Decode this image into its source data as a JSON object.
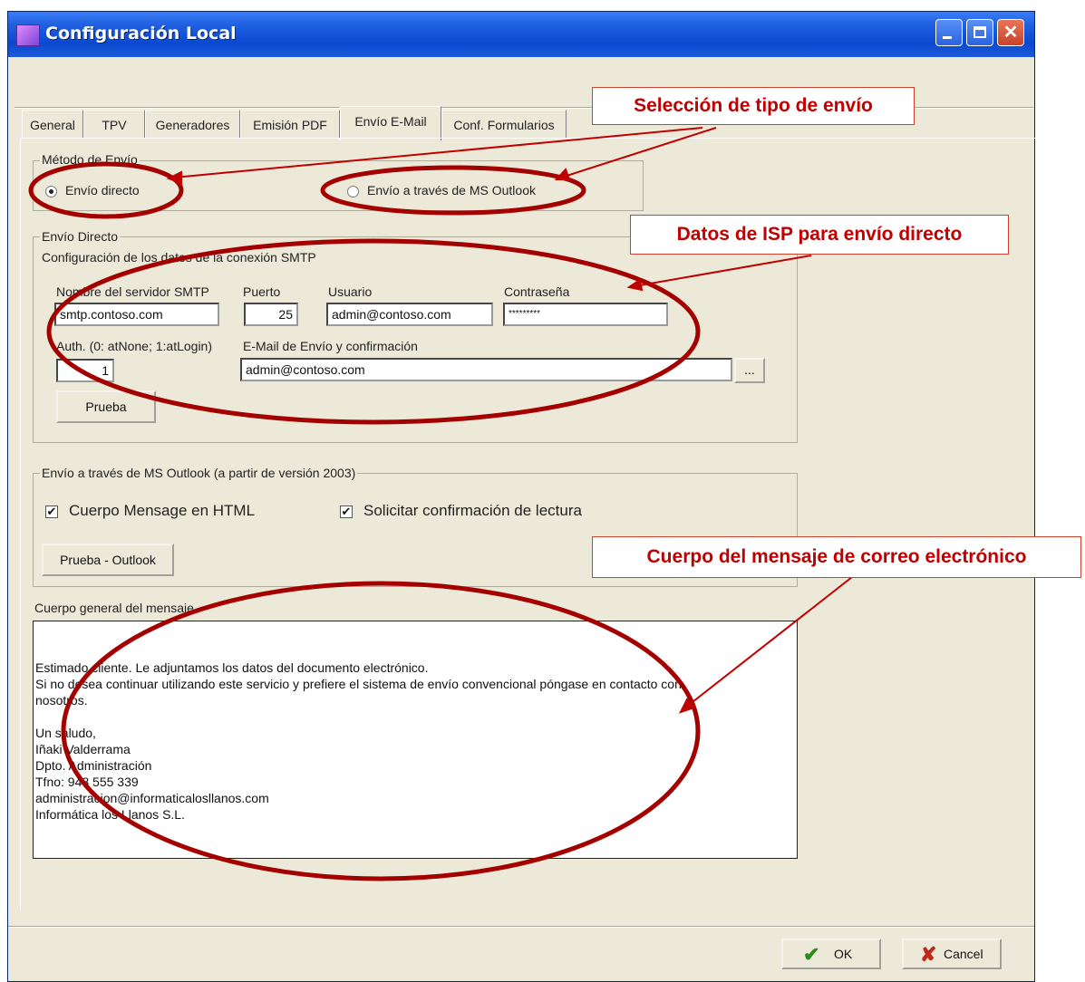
{
  "window": {
    "title": "Configuración Local"
  },
  "tabs": [
    {
      "label": "General",
      "active": false
    },
    {
      "label": "TPV",
      "active": false
    },
    {
      "label": "Generadores",
      "active": false
    },
    {
      "label": "Emisión PDF",
      "active": false
    },
    {
      "label": "Envío E-Mail",
      "active": true
    },
    {
      "label": "Conf. Formularios",
      "active": false
    }
  ],
  "method": {
    "group_title": "Método de Envío",
    "direct_label": "Envío directo",
    "outlook_label": "Envío a través de MS Outlook",
    "selected": "direct"
  },
  "direct": {
    "group_title": "Envío Directo",
    "subtitle": "Configuración de los datos de la conexión SMTP",
    "server_label": "Nombre del servidor SMTP",
    "server_value": "smtp.contoso.com",
    "port_label": "Puerto",
    "port_value": "25",
    "user_label": "Usuario",
    "user_value": "admin@contoso.com",
    "password_label": "Contraseña",
    "password_value": "*********",
    "auth_label": "Auth. (0: atNone; 1:atLogin)",
    "auth_value": "1",
    "email_label": "E-Mail de Envío y confirmación",
    "email_value": "admin@contoso.com",
    "browse_label": "...",
    "test_button": "Prueba"
  },
  "outlook": {
    "group_title": "Envío a través de MS Outlook (a partir de versión 2003)",
    "html_body_label": "Cuerpo Mensage en HTML",
    "html_body_checked": true,
    "read_receipt_label": "Solicitar confirmación de lectura",
    "read_receipt_checked": true,
    "test_button": "Prueba - Outlook"
  },
  "message": {
    "label": "Cuerpo general del mensaje",
    "body": "Estimado cliente. Le adjuntamos los datos del documento electrónico.\nSi no desea continuar utilizando este servicio y prefiere el sistema de envío convencional póngase en contacto con\nnosotros.\n\nUn saludo,\nIñaki Valderrama\nDpto. Administración\nTfno: 948 555 339\nadministracion@informaticalosllanos.com\nInformática los Llanos S.L."
  },
  "footer": {
    "ok_label": "OK",
    "cancel_label": "Cancel"
  },
  "callouts": {
    "send_type": "Selección de tipo de envío",
    "isp": "Datos de ISP para envío directo",
    "body": "Cuerpo del mensaje de correo electrónico"
  },
  "colors": {
    "callout": "#c00000",
    "ellipse": "#a50000",
    "titlebar": "#0a48d0",
    "dialog": "#ece9d8"
  }
}
